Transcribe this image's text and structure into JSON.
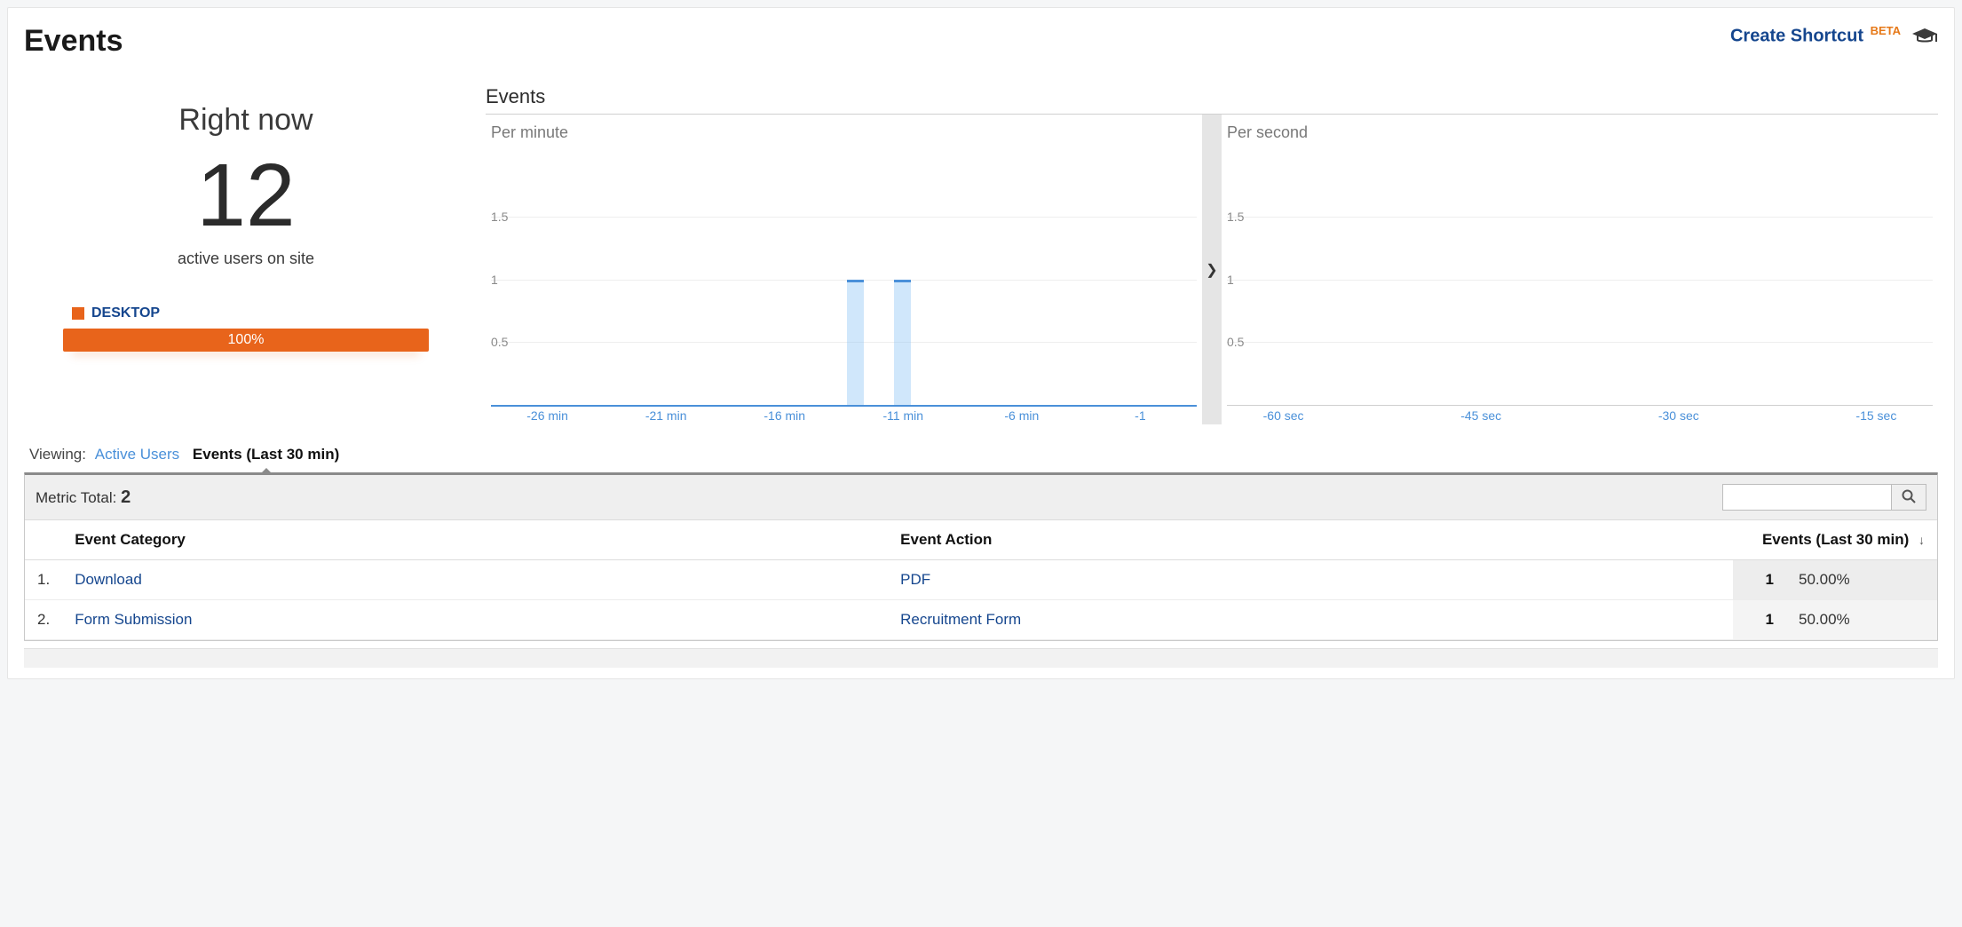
{
  "header": {
    "title": "Events",
    "create_shortcut_label": "Create Shortcut",
    "beta_label": "BETA"
  },
  "right_now": {
    "title": "Right now",
    "value": "12",
    "subtitle": "active users on site",
    "legend_label": "DESKTOP",
    "bar_percent": "100%",
    "accent_color": "#e8641b"
  },
  "charts": {
    "section_title": "Events",
    "per_minute_label": "Per minute",
    "per_second_label": "Per second"
  },
  "chart_data": [
    {
      "type": "bar",
      "title": "Per minute",
      "xlabel": "",
      "ylabel": "",
      "ylim": [
        0,
        2
      ],
      "y_ticks": [
        0.5,
        1.0,
        1.5
      ],
      "x_tick_labels": [
        "-26 min",
        "-21 min",
        "-16 min",
        "-11 min",
        "-6 min",
        "-1"
      ],
      "categories": [
        "-30",
        "-29",
        "-28",
        "-27",
        "-26",
        "-25",
        "-24",
        "-23",
        "-22",
        "-21",
        "-20",
        "-19",
        "-18",
        "-17",
        "-16",
        "-15",
        "-14",
        "-13",
        "-12",
        "-11",
        "-10",
        "-9",
        "-8",
        "-7",
        "-6",
        "-5",
        "-4",
        "-3",
        "-2",
        "-1"
      ],
      "values": [
        0,
        0,
        0,
        0,
        0,
        0,
        0,
        0,
        0,
        0,
        0,
        0,
        0,
        0,
        0,
        1,
        0,
        1,
        0,
        0,
        0,
        0,
        0,
        0,
        0,
        0,
        0,
        0,
        0,
        0
      ]
    },
    {
      "type": "bar",
      "title": "Per second",
      "xlabel": "",
      "ylabel": "",
      "ylim": [
        0,
        2
      ],
      "y_ticks": [
        0.5,
        1,
        1.5
      ],
      "x_tick_labels": [
        "-60 sec",
        "-45 sec",
        "-30 sec",
        "-15 sec"
      ],
      "categories": [
        "-60",
        "-45",
        "-30",
        "-15"
      ],
      "values": [
        0,
        0,
        0,
        0
      ]
    }
  ],
  "viewing": {
    "label": "Viewing:",
    "link_active_users": "Active Users",
    "tab_events": "Events (Last 30 min)"
  },
  "table": {
    "metric_total_label": "Metric Total:",
    "metric_total_value": "2",
    "search_placeholder": "",
    "columns": {
      "cat": "Event Category",
      "action": "Event Action",
      "count": "Events (Last 30 min)"
    },
    "rows": [
      {
        "idx": "1.",
        "category": "Download",
        "action": "PDF",
        "count": "1",
        "pct": "50.00%"
      },
      {
        "idx": "2.",
        "category": "Form Submission",
        "action": "Recruitment Form",
        "count": "1",
        "pct": "50.00%"
      }
    ]
  }
}
